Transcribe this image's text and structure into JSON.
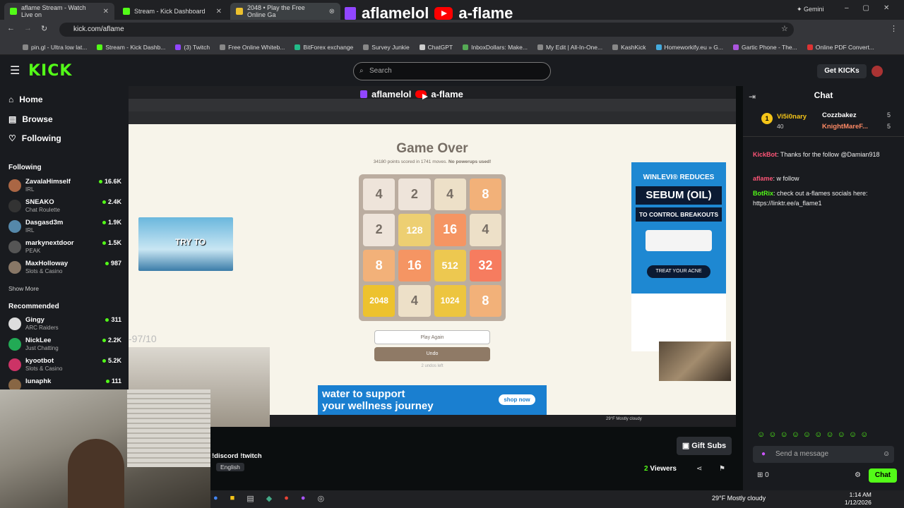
{
  "browser": {
    "tabs": [
      {
        "title": "aflame Stream - Watch Live on"
      },
      {
        "title": "Stream - Kick Dashboard"
      },
      {
        "title": "2048 • Play the Free Online Ga"
      }
    ],
    "url": "kick.com/aflame",
    "gemini_label": "Gemini",
    "bookmarks": [
      "pin.gl - Ultra low lat...",
      "Stream - Kick Dashb...",
      "(3) Twitch",
      "Free Online Whiteb...",
      "BitForex exchange",
      "Survey Junkie",
      "ChatGPT",
      "InboxDollars: Make...",
      "My Edit | All-In-One...",
      "KashKick",
      "Homeworkify.eu » G...",
      "Gartic Phone - The...",
      "Online PDF Convert..."
    ]
  },
  "overlay": {
    "twitch_name": "aflamelol",
    "youtube_name": "a-flame"
  },
  "kick": {
    "logo": "KICK",
    "search_placeholder": "Search",
    "get_kicks": "Get KICKs"
  },
  "sidebar": {
    "nav": [
      {
        "label": "Home",
        "icon": "home-icon"
      },
      {
        "label": "Browse",
        "icon": "browse-icon"
      },
      {
        "label": "Following",
        "icon": "heart-icon"
      }
    ],
    "following_heading": "Following",
    "following": [
      {
        "name": "ZavalaHimself",
        "category": "IRL",
        "viewers": "16.6K"
      },
      {
        "name": "SNEAKO",
        "category": "Chat Roulette",
        "viewers": "2.4K"
      },
      {
        "name": "Dasgasd3m",
        "category": "IRL",
        "viewers": "1.9K"
      },
      {
        "name": "markynextdoor",
        "category": "PEAK",
        "viewers": "1.5K"
      },
      {
        "name": "MaxHolloway",
        "category": "Slots & Casino",
        "viewers": "987"
      }
    ],
    "show_more": "Show More",
    "recommended_heading": "Recommended",
    "recommended": [
      {
        "name": "Gingy",
        "category": "ARC Raiders",
        "viewers": "311"
      },
      {
        "name": "NickLee",
        "category": "Just Chatting",
        "viewers": "2.2K"
      },
      {
        "name": "kyootbot",
        "category": "Slots & Casino",
        "viewers": "5.2K"
      },
      {
        "name": "lunaphk",
        "category": "",
        "viewers": "111"
      }
    ]
  },
  "game": {
    "title": "Game Over",
    "score_line": "34180 points scored in 1741 moves.",
    "powerups": "No powerups used!",
    "board": [
      [
        "4",
        "2",
        "4",
        "8"
      ],
      [
        "2",
        "128",
        "16",
        "4"
      ],
      [
        "8",
        "16",
        "512",
        "32"
      ],
      [
        "2048",
        "4",
        "1024",
        "8"
      ]
    ],
    "play_again": "Play Again",
    "undo": "Undo",
    "undo_sub": "2 undos left",
    "overlay_score": "-97/10",
    "ad_top": "WINLEVI® REDUCES",
    "ad_mid": "SEBUM (OIL)",
    "ad_sub": "TO CONTROL BREAKOUTS",
    "ad_cta": "TREAT YOUR ACNE",
    "ad_bottom_line1": "water to support",
    "ad_bottom_line2": "your wellness journey",
    "ad_bottom_cta": "shop now",
    "meme_text": "TRY TO",
    "inner_weather": "29°F Mostly cloudy"
  },
  "chat": {
    "title": "Chat",
    "top_gifters": [
      {
        "name": "Vi5i0nary",
        "count": "40"
      },
      {
        "name": "Cozzbakez",
        "count": "5"
      },
      {
        "name": "KnightMareF...",
        "count": "5"
      }
    ],
    "messages": [
      {
        "user": "KickBot",
        "text": ": Thanks for the follow @Damian918"
      },
      {
        "user": "aflame",
        "text": ": w follow"
      },
      {
        "user": "BotRix",
        "text": ": check out a-flames socials here: https://linktr.ee/a_flame1"
      }
    ],
    "input_placeholder": "Send a message",
    "points": "0",
    "chat_button": "Chat"
  },
  "stream": {
    "title_snippet": "!discord !twitch",
    "language": "English",
    "viewers": "2",
    "viewers_label": "Viewers",
    "gift_subs": "Gift Subs"
  },
  "taskbar": {
    "weather": "29°F",
    "weather_desc": "Mostly cloudy",
    "time": "1:14 AM",
    "date": "1/12/2026"
  },
  "colors": {
    "kick_green": "#53fc18",
    "bg": "#0b0e0f",
    "panel": "#191b1f"
  }
}
